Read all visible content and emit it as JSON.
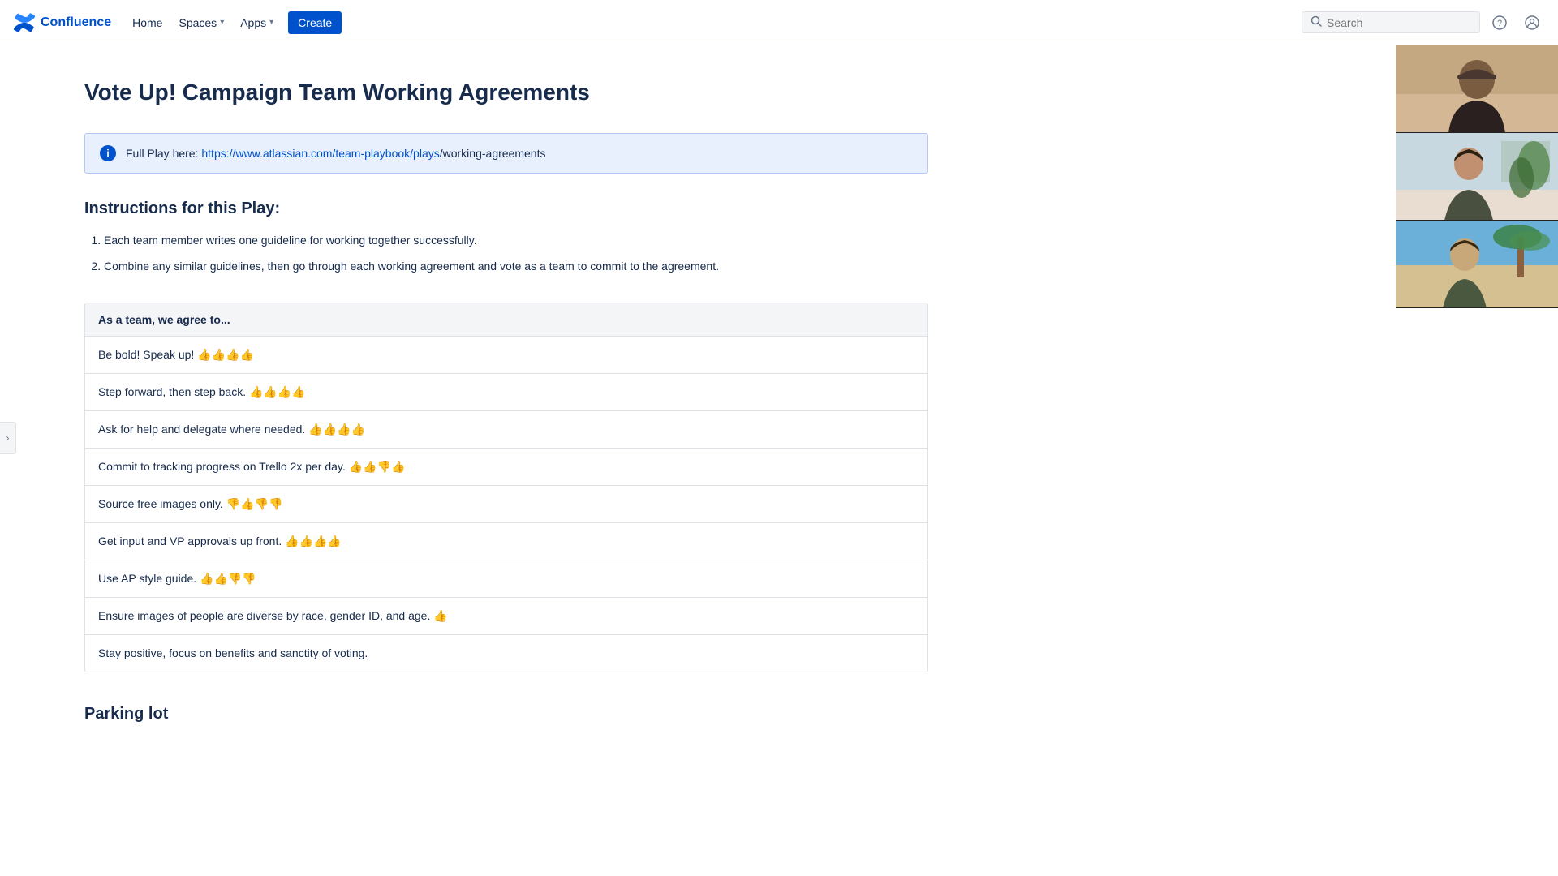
{
  "nav": {
    "logo_text": "Confluence",
    "home_label": "Home",
    "spaces_label": "Spaces",
    "apps_label": "Apps",
    "create_label": "Create"
  },
  "search": {
    "placeholder": "Search"
  },
  "page": {
    "title": "Vote Up! Campaign Team Working Agreements"
  },
  "info_panel": {
    "text_before_link": "Full Play here: ",
    "link_text": "https://www.atlassian.com/team-playbook/plays",
    "text_after_link": "/working-agreements"
  },
  "instructions": {
    "title": "Instructions for this Play:",
    "items": [
      "Each team member writes one guideline for working together successfully.",
      "Combine any similar guidelines, then go through each working agreement and vote as a team to commit to the agreement."
    ]
  },
  "agreement_table": {
    "header": "As a team, we agree to...",
    "rows": [
      "Be bold! Speak up! 👍👍👍👍",
      "Step forward, then step back. 👍👍👍👍",
      "Ask for help and delegate where needed. 👍👍👍👍",
      "Commit to tracking progress on Trello 2x per day. 👍👍👎👍",
      "Source free images only. 👎👍👎👎",
      "Get input and VP approvals up front. 👍👍👍👍",
      "Use AP style guide. 👍👍👎👎",
      "Ensure images of people are diverse by race, gender ID, and age. 👍",
      "Stay positive, focus on benefits and sanctity of voting."
    ]
  },
  "parking_lot": {
    "title": "Parking lot"
  },
  "sidebar_toggle": {
    "icon": "›"
  }
}
